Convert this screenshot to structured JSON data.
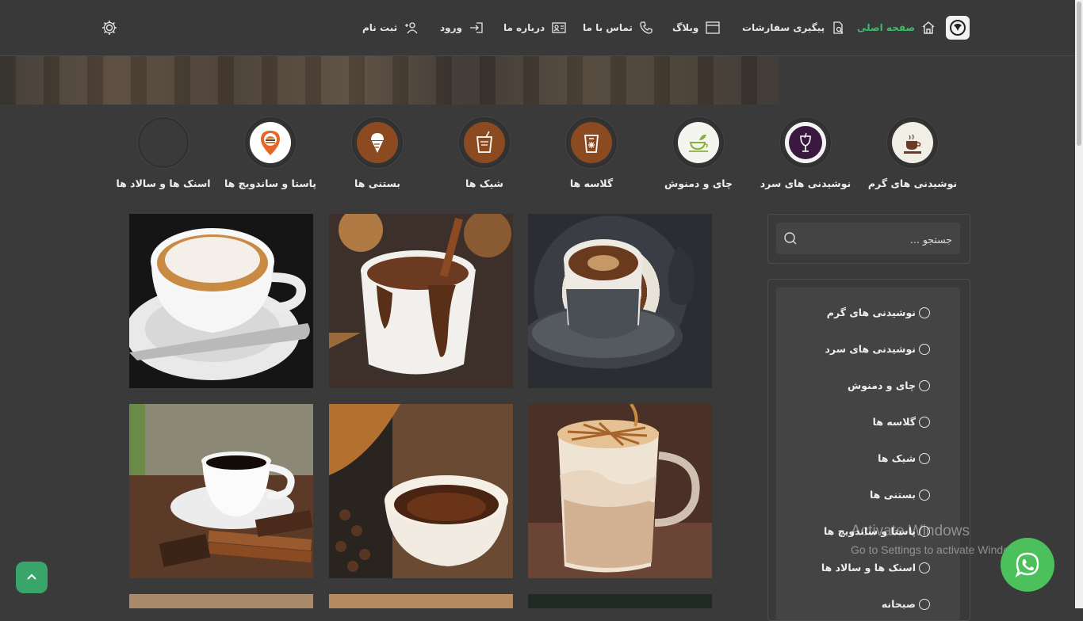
{
  "nav": {
    "home": "صفحه اصلی",
    "orders": "پیگیری سفارشات",
    "blog": "وبلاگ",
    "contact": "تماس با ما",
    "about": "درباره ما",
    "login": "ورود",
    "register": "ثبت نام"
  },
  "categories": [
    {
      "label": "نوشیدنی های گرم",
      "icon": "coffee-cup-icon"
    },
    {
      "label": "نوشیدنی های سرد",
      "icon": "cold-drink-icon"
    },
    {
      "label": "چای و دمنوش",
      "icon": "tea-cup-icon"
    },
    {
      "label": "گلاسه ها",
      "icon": "iced-glass-icon"
    },
    {
      "label": "شیک ها",
      "icon": "shake-icon"
    },
    {
      "label": "بستنی ها",
      "icon": "ice-cream-icon"
    },
    {
      "label": "پاستا و ساندویچ ها",
      "icon": "burger-pin-icon"
    },
    {
      "label": "اسنک ها و سالاد ها",
      "icon": ""
    }
  ],
  "search": {
    "placeholder": "جستجو ..."
  },
  "filters": [
    "نوشیدنی های گرم",
    "نوشیدنی های سرد",
    "چای و دمنوش",
    "گلاسه ها",
    "شیک ها",
    "بستنی ها",
    "پاستا و ساندویچ ها",
    "اسنک ها و سالاد ها",
    "صبحانه"
  ],
  "products": [
    {
      "image": "turkish-coffee-photo"
    },
    {
      "image": "hot-chocolate-photo"
    },
    {
      "image": "cappuccino-photo"
    },
    {
      "image": "caramel-latte-photo"
    },
    {
      "image": "espresso-cup-photo"
    },
    {
      "image": "black-coffee-photo"
    }
  ],
  "watermark": {
    "title": "Activate Windows",
    "subtitle": "Go to Settings to activate Windows."
  },
  "colors": {
    "accent": "#3dbb6a",
    "background": "#3a3a3a",
    "whatsapp": "#4cc15b"
  }
}
